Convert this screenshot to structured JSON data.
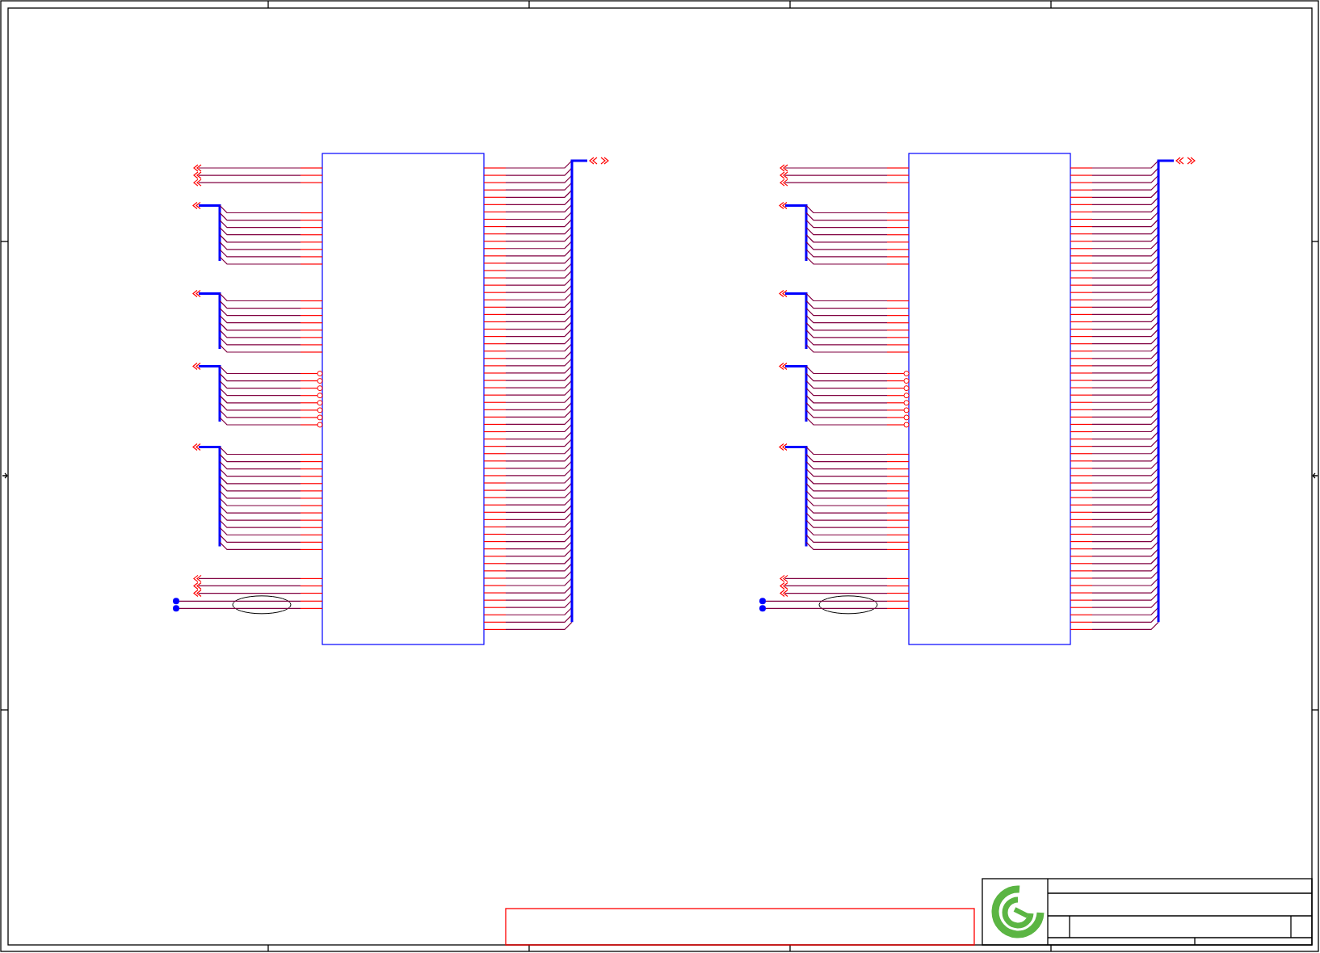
{
  "sheet": {
    "parts": [
      {
        "left_groups": [
          {
            "kind": "ports",
            "wires": [
              {
                "inverted": false
              },
              {
                "inverted": false
              },
              {
                "inverted": false
              }
            ]
          },
          {
            "kind": "bus",
            "wires": [
              {
                "inverted": false
              },
              {
                "inverted": false
              },
              {
                "inverted": false
              },
              {
                "inverted": false
              },
              {
                "inverted": false
              },
              {
                "inverted": false
              },
              {
                "inverted": false
              },
              {
                "inverted": false
              }
            ]
          },
          {
            "kind": "bus",
            "wires": [
              {
                "inverted": false
              },
              {
                "inverted": false
              },
              {
                "inverted": false
              },
              {
                "inverted": false
              },
              {
                "inverted": false
              },
              {
                "inverted": false
              },
              {
                "inverted": false
              },
              {
                "inverted": false
              }
            ]
          },
          {
            "kind": "bus",
            "wires": [
              {
                "inverted": true
              },
              {
                "inverted": true
              },
              {
                "inverted": true
              },
              {
                "inverted": true
              },
              {
                "inverted": true
              },
              {
                "inverted": true
              },
              {
                "inverted": true
              },
              {
                "inverted": true
              }
            ]
          },
          {
            "kind": "bus",
            "wires": [
              {
                "inverted": false
              },
              {
                "inverted": false
              },
              {
                "inverted": false
              },
              {
                "inverted": false
              },
              {
                "inverted": false
              },
              {
                "inverted": false
              },
              {
                "inverted": false
              },
              {
                "inverted": false
              },
              {
                "inverted": false
              },
              {
                "inverted": false
              },
              {
                "inverted": false
              },
              {
                "inverted": false
              },
              {
                "inverted": false
              },
              {
                "inverted": false
              }
            ]
          },
          {
            "kind": "ports",
            "wires": [
              {
                "inverted": false
              },
              {
                "inverted": false
              },
              {
                "inverted": false
              }
            ]
          },
          {
            "kind": "terminals",
            "wires": [
              {
                "inverted": false
              },
              {
                "inverted": false
              }
            ]
          }
        ],
        "right_bus": {
          "wires": [
            {
              "inverted": false
            },
            {
              "inverted": false
            },
            {
              "inverted": false
            },
            {
              "inverted": false
            },
            {
              "inverted": false
            },
            {
              "inverted": false
            },
            {
              "inverted": false
            },
            {
              "inverted": false
            },
            {
              "inverted": false
            },
            {
              "inverted": false
            },
            {
              "inverted": false
            },
            {
              "inverted": false
            },
            {
              "inverted": false
            },
            {
              "inverted": false
            },
            {
              "inverted": false
            },
            {
              "inverted": false
            },
            {
              "inverted": false
            },
            {
              "inverted": false
            },
            {
              "inverted": false
            },
            {
              "inverted": false
            },
            {
              "inverted": false
            },
            {
              "inverted": false
            },
            {
              "inverted": false
            },
            {
              "inverted": false
            },
            {
              "inverted": false
            },
            {
              "inverted": false
            },
            {
              "inverted": false
            },
            {
              "inverted": false
            },
            {
              "inverted": false
            },
            {
              "inverted": false
            },
            {
              "inverted": false
            },
            {
              "inverted": false
            },
            {
              "inverted": false
            },
            {
              "inverted": false
            },
            {
              "inverted": false
            },
            {
              "inverted": false
            },
            {
              "inverted": false
            },
            {
              "inverted": false
            },
            {
              "inverted": false
            },
            {
              "inverted": false
            },
            {
              "inverted": false
            },
            {
              "inverted": false
            },
            {
              "inverted": false
            },
            {
              "inverted": false
            },
            {
              "inverted": false
            },
            {
              "inverted": false
            },
            {
              "inverted": false
            },
            {
              "inverted": false
            },
            {
              "inverted": false
            },
            {
              "inverted": false
            },
            {
              "inverted": false
            },
            {
              "inverted": false
            },
            {
              "inverted": false
            },
            {
              "inverted": false
            },
            {
              "inverted": false
            },
            {
              "inverted": false
            },
            {
              "inverted": false
            },
            {
              "inverted": false
            },
            {
              "inverted": false
            },
            {
              "inverted": false
            },
            {
              "inverted": false
            },
            {
              "inverted": false
            },
            {
              "inverted": false
            },
            {
              "inverted": false
            }
          ]
        }
      },
      {
        "left_groups": [
          {
            "kind": "ports",
            "wires": [
              {
                "inverted": false
              },
              {
                "inverted": false
              },
              {
                "inverted": false
              }
            ]
          },
          {
            "kind": "bus",
            "wires": [
              {
                "inverted": false
              },
              {
                "inverted": false
              },
              {
                "inverted": false
              },
              {
                "inverted": false
              },
              {
                "inverted": false
              },
              {
                "inverted": false
              },
              {
                "inverted": false
              },
              {
                "inverted": false
              }
            ]
          },
          {
            "kind": "bus",
            "wires": [
              {
                "inverted": false
              },
              {
                "inverted": false
              },
              {
                "inverted": false
              },
              {
                "inverted": false
              },
              {
                "inverted": false
              },
              {
                "inverted": false
              },
              {
                "inverted": false
              },
              {
                "inverted": false
              }
            ]
          },
          {
            "kind": "bus",
            "wires": [
              {
                "inverted": true
              },
              {
                "inverted": true
              },
              {
                "inverted": true
              },
              {
                "inverted": true
              },
              {
                "inverted": true
              },
              {
                "inverted": true
              },
              {
                "inverted": true
              },
              {
                "inverted": true
              }
            ]
          },
          {
            "kind": "bus",
            "wires": [
              {
                "inverted": false
              },
              {
                "inverted": false
              },
              {
                "inverted": false
              },
              {
                "inverted": false
              },
              {
                "inverted": false
              },
              {
                "inverted": false
              },
              {
                "inverted": false
              },
              {
                "inverted": false
              },
              {
                "inverted": false
              },
              {
                "inverted": false
              },
              {
                "inverted": false
              },
              {
                "inverted": false
              },
              {
                "inverted": false
              },
              {
                "inverted": false
              }
            ]
          },
          {
            "kind": "ports",
            "wires": [
              {
                "inverted": false
              },
              {
                "inverted": false
              },
              {
                "inverted": false
              }
            ]
          },
          {
            "kind": "terminals",
            "wires": [
              {
                "inverted": false
              },
              {
                "inverted": false
              }
            ]
          }
        ],
        "right_bus": {
          "wires": [
            {
              "inverted": false
            },
            {
              "inverted": false
            },
            {
              "inverted": false
            },
            {
              "inverted": false
            },
            {
              "inverted": false
            },
            {
              "inverted": false
            },
            {
              "inverted": false
            },
            {
              "inverted": false
            },
            {
              "inverted": false
            },
            {
              "inverted": false
            },
            {
              "inverted": false
            },
            {
              "inverted": false
            },
            {
              "inverted": false
            },
            {
              "inverted": false
            },
            {
              "inverted": false
            },
            {
              "inverted": false
            },
            {
              "inverted": false
            },
            {
              "inverted": false
            },
            {
              "inverted": false
            },
            {
              "inverted": false
            },
            {
              "inverted": false
            },
            {
              "inverted": false
            },
            {
              "inverted": false
            },
            {
              "inverted": false
            },
            {
              "inverted": false
            },
            {
              "inverted": false
            },
            {
              "inverted": false
            },
            {
              "inverted": false
            },
            {
              "inverted": false
            },
            {
              "inverted": false
            },
            {
              "inverted": false
            },
            {
              "inverted": false
            },
            {
              "inverted": false
            },
            {
              "inverted": false
            },
            {
              "inverted": false
            },
            {
              "inverted": false
            },
            {
              "inverted": false
            },
            {
              "inverted": false
            },
            {
              "inverted": false
            },
            {
              "inverted": false
            },
            {
              "inverted": false
            },
            {
              "inverted": false
            },
            {
              "inverted": false
            },
            {
              "inverted": false
            },
            {
              "inverted": false
            },
            {
              "inverted": false
            },
            {
              "inverted": false
            },
            {
              "inverted": false
            },
            {
              "inverted": false
            },
            {
              "inverted": false
            },
            {
              "inverted": false
            },
            {
              "inverted": false
            },
            {
              "inverted": false
            },
            {
              "inverted": false
            },
            {
              "inverted": false
            },
            {
              "inverted": false
            },
            {
              "inverted": false
            },
            {
              "inverted": false
            },
            {
              "inverted": false
            },
            {
              "inverted": false
            },
            {
              "inverted": false
            },
            {
              "inverted": false
            },
            {
              "inverted": false
            },
            {
              "inverted": false
            }
          ]
        }
      }
    ]
  }
}
